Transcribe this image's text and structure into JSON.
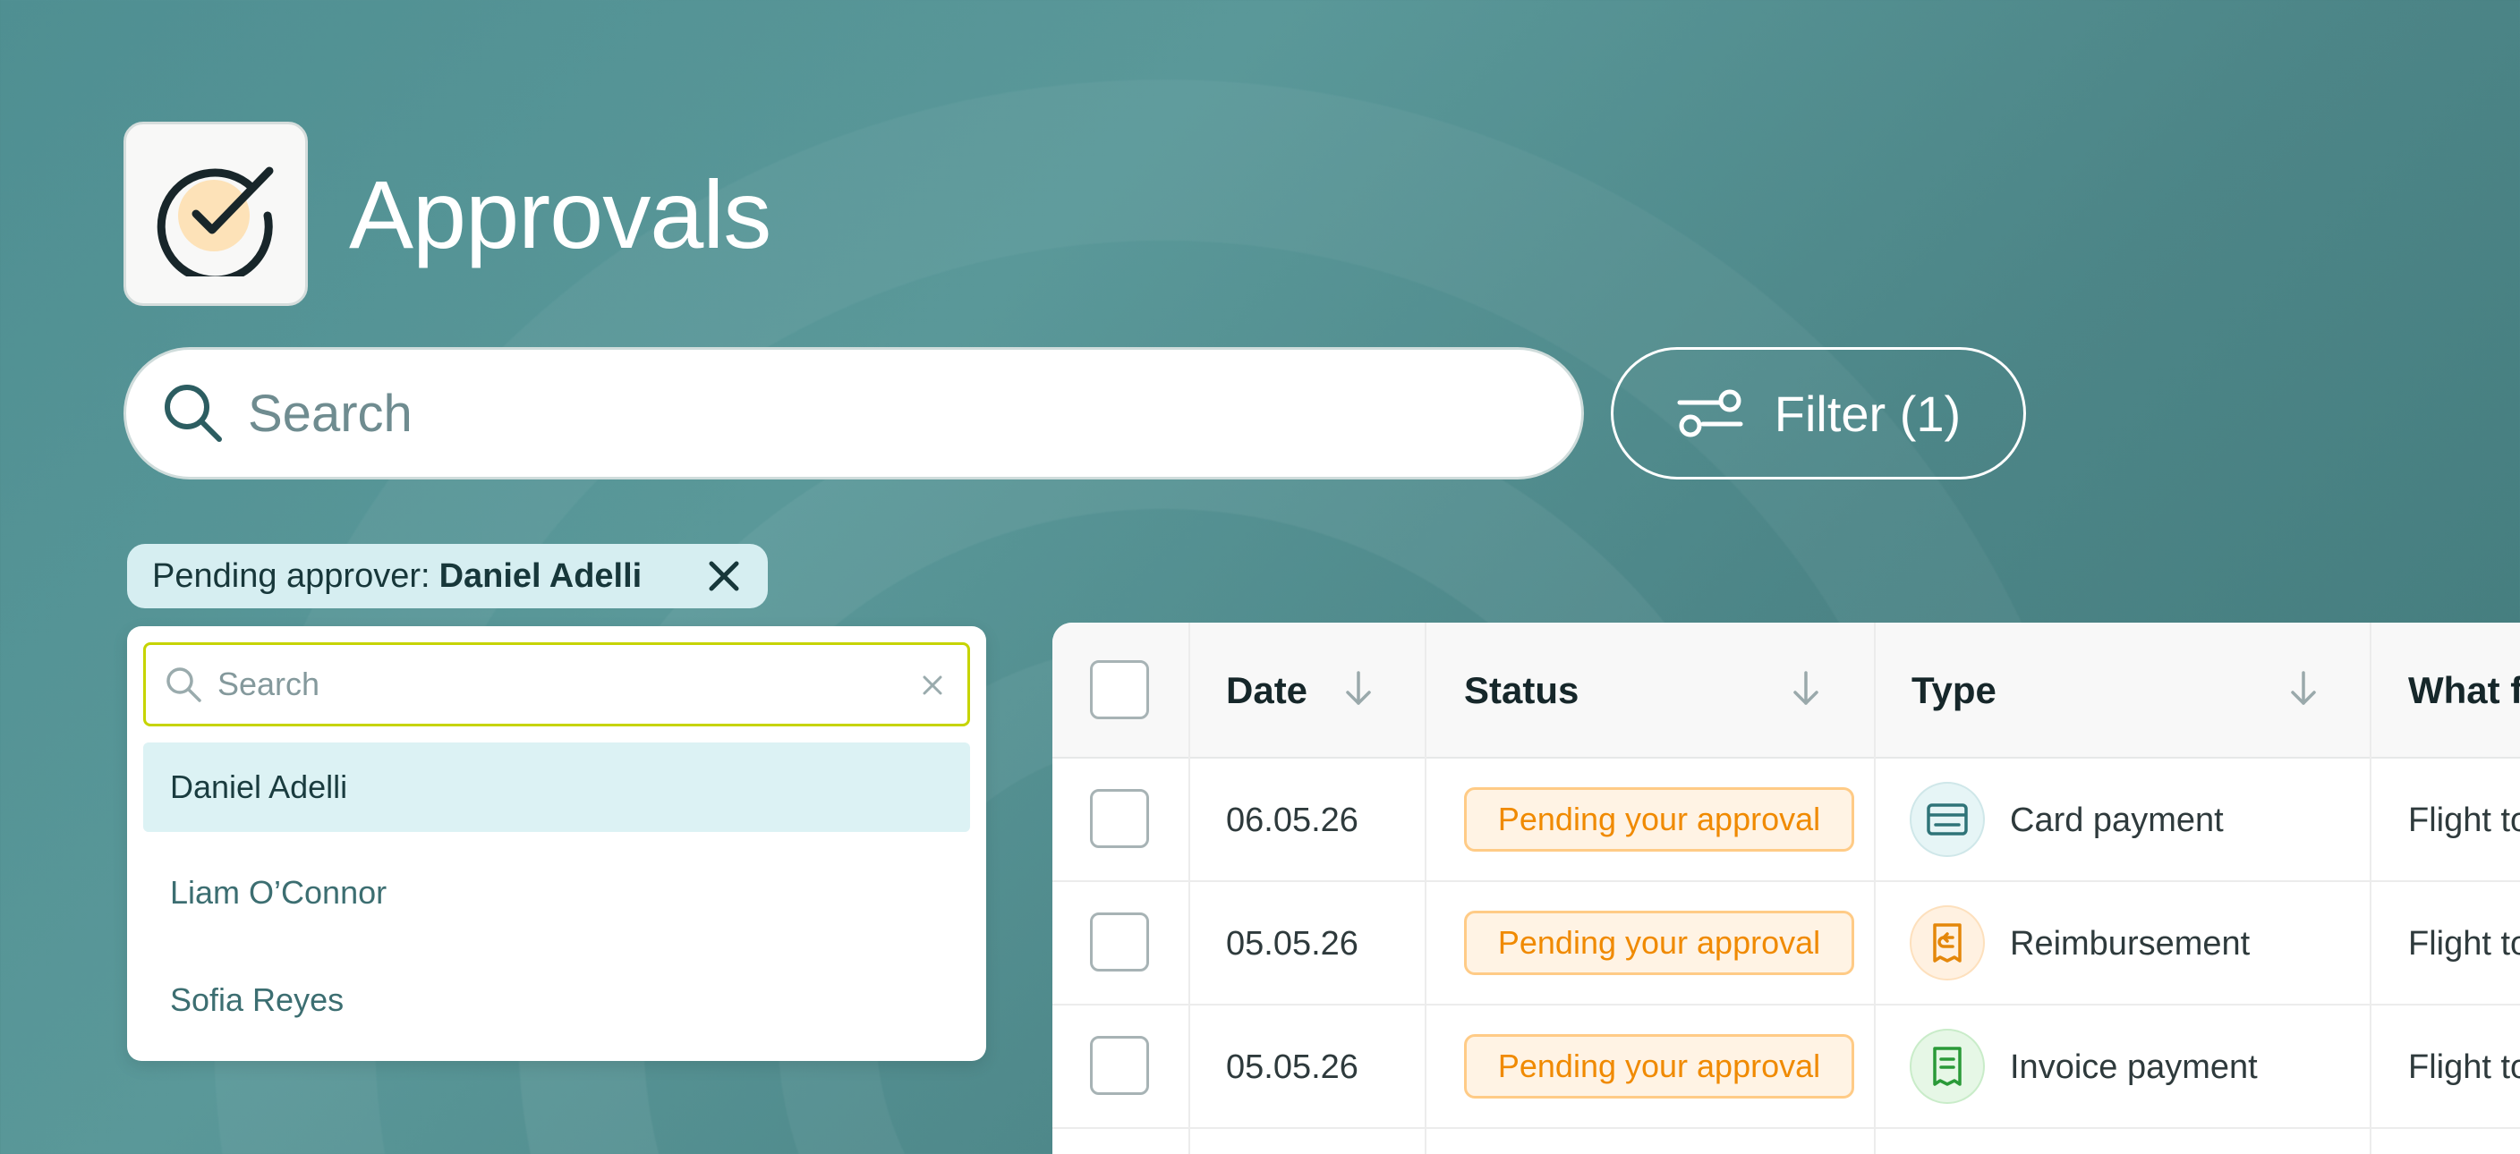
{
  "header": {
    "title": "Approvals",
    "icon": "check-circle-icon"
  },
  "search": {
    "placeholder": "Search"
  },
  "filter_button": {
    "label": "Filter (1)",
    "icon": "sliders-icon"
  },
  "active_filter_chip": {
    "label": "Pending approver:",
    "value": "Daniel Adelli"
  },
  "approver_dropdown": {
    "search_placeholder": "Search",
    "options": [
      {
        "label": "Daniel Adelli",
        "selected": true
      },
      {
        "label": "Liam O’Connor",
        "selected": false
      },
      {
        "label": "Sofia Reyes",
        "selected": false
      }
    ]
  },
  "table": {
    "columns": [
      "Date",
      "Status",
      "Type",
      "What f"
    ],
    "rows": [
      {
        "date": "06.05.26",
        "status": "Pending your approval",
        "type": "Card payment",
        "type_icon": "card-icon",
        "what": "Flight to"
      },
      {
        "date": "05.05.26",
        "status": "Pending your approval",
        "type": "Reimbursement",
        "type_icon": "receipt-return-icon",
        "what": "Flight to"
      },
      {
        "date": "05.05.26",
        "status": "Pending your approval",
        "type": "Invoice payment",
        "type_icon": "invoice-icon",
        "what": "Flight to"
      }
    ]
  },
  "colors": {
    "background": "#4f8f92",
    "status_pending_text": "#f08a00",
    "status_pending_bg": "#fff3e4",
    "chip_bg": "#d6eef1",
    "dropdown_focus_border": "#c6d400"
  }
}
